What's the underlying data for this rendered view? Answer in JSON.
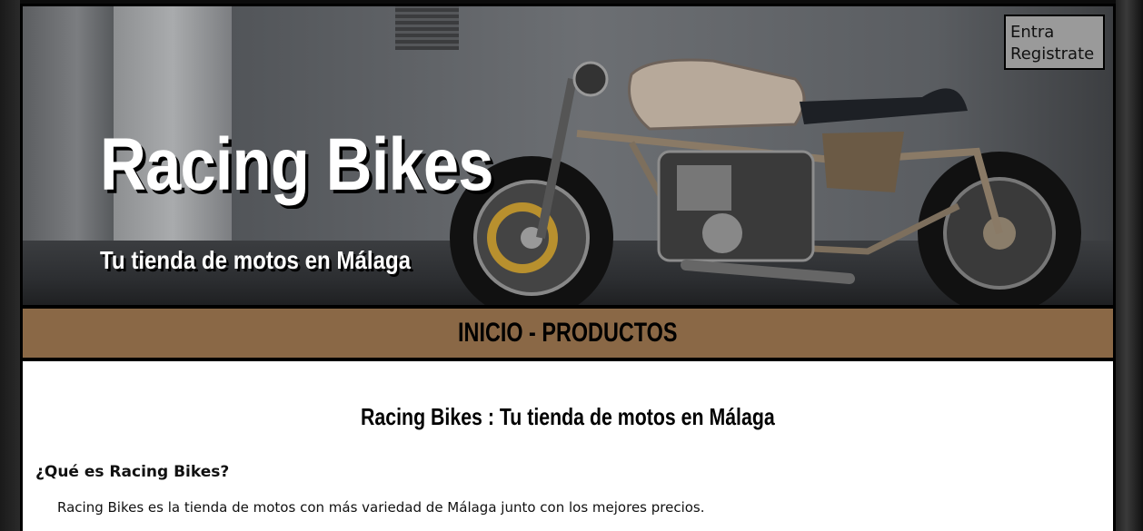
{
  "header": {
    "title": "Racing Bikes",
    "subtitle": "Tu tienda de motos en Málaga",
    "login_label": "Entra",
    "register_label": "Registrate"
  },
  "nav": {
    "home_label": "INICIO",
    "separator": " - ",
    "products_label": "PRODUCTOS"
  },
  "main": {
    "title": "Racing Bikes : Tu tienda de motos en Málaga",
    "section_heading": "¿Qué es Racing Bikes?",
    "section_text": "Racing Bikes es la tienda de motos con más variedad de Málaga junto con los mejores precios."
  },
  "colors": {
    "nav_background": "#8a6846",
    "content_background": "#ffffff",
    "frame": "#000000"
  },
  "icons": {
    "hero_image": "motorcycle-photo"
  }
}
